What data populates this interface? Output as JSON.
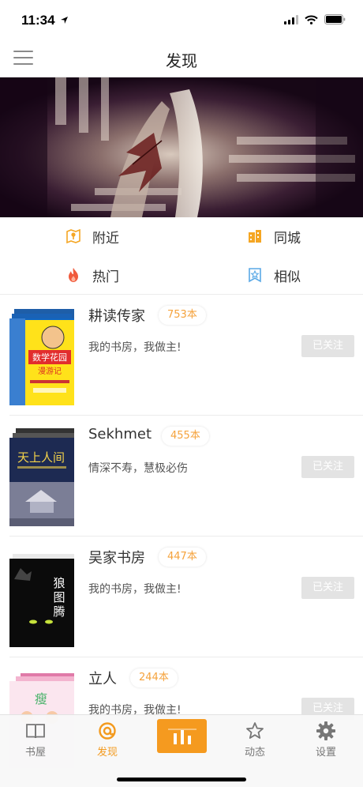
{
  "status_bar": {
    "time": "11:34"
  },
  "navbar": {
    "title": "发现"
  },
  "categories": [
    {
      "label": "附近",
      "icon": "map-pin-icon",
      "color": "#f5a623"
    },
    {
      "label": "同城",
      "icon": "buildings-icon",
      "color": "#f5a623"
    },
    {
      "label": "热门",
      "icon": "flame-icon",
      "color": "#f05a3c"
    },
    {
      "label": "相似",
      "icon": "bookmark-star-icon",
      "color": "#5aa9e6"
    }
  ],
  "users": [
    {
      "name": "耕读传家",
      "count": "753本",
      "desc": "我的书房，我做主!",
      "follow_label": "已关注",
      "cover_title": "数学花园漫游记"
    },
    {
      "name": "Sekhmet",
      "count": "455本",
      "desc": "情深不寿，慧极必伤",
      "follow_label": "已关注",
      "cover_title": "天上人间"
    },
    {
      "name": "吴家书房",
      "count": "447本",
      "desc": "我的书房，我做主!",
      "follow_label": "已关注",
      "cover_title": "狼图腾"
    },
    {
      "name": "立人",
      "count": "244本",
      "desc": "我的书房，我做主!",
      "follow_label": "已关注",
      "cover_title": "瘦"
    }
  ],
  "tabbar": {
    "items": [
      {
        "label": "书屋",
        "icon": "book-icon"
      },
      {
        "label": "发现",
        "icon": "discover-icon",
        "active": true
      },
      {
        "label": "动态",
        "icon": "star-icon"
      },
      {
        "label": "设置",
        "icon": "gear-icon"
      }
    ],
    "accent": "#f59a1f"
  }
}
